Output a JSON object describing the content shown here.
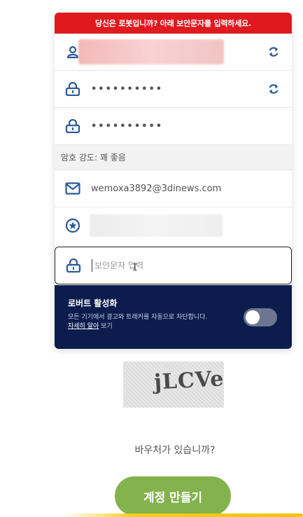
{
  "banner": {
    "text": "당신은 로봇입니까? 아래 보안문자를 입력하세요."
  },
  "form": {
    "password_value": "••••••••••",
    "confirm_value": "••••••••••",
    "strength_text": "암호 강도: 꽤 좋음",
    "email_value": "wemoxa3892@3dinews.com",
    "captcha_placeholder": "보안문자 입력"
  },
  "robot": {
    "title": "로버트 활성화",
    "desc_prefix": "모든 기기에서 광고와 트래커를 자동으로 차단합니다. ",
    "link": "자세히 알아",
    "desc_suffix": " 보기",
    "toggle_on": false
  },
  "captcha": {
    "text": "jLCVe"
  },
  "voucher": {
    "text": "바우처가 있습니까?"
  },
  "create_button": {
    "label": "계정 만들기"
  },
  "colors": {
    "banner": "#e0191e",
    "icon": "#2a5a9a",
    "robot_bg": "#0c1d4d",
    "button": "#84b24d"
  },
  "icons": {
    "username": "user-icon",
    "password": "lock-icon",
    "refresh": "refresh-icon",
    "email": "mail-icon",
    "referral": "star-circle-icon"
  }
}
